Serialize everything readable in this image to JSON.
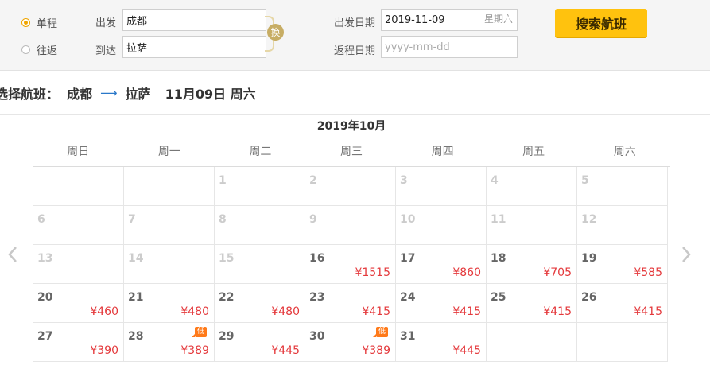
{
  "trip_type": {
    "options": [
      {
        "label": "单程",
        "checked": true
      },
      {
        "label": "往返",
        "checked": false
      }
    ]
  },
  "form": {
    "depart_label": "出发",
    "arrive_label": "到达",
    "depart_city": "成都",
    "arrive_city": "拉萨",
    "swap_label": "换",
    "depart_date_label": "出发日期",
    "return_date_label": "返程日期",
    "depart_date": "2019-11-09",
    "depart_weekday": "星期六",
    "return_date_placeholder": "yyyy-mm-dd",
    "search_button": "搜索航班"
  },
  "heading": {
    "prefix": "选择航班：",
    "from": "成都",
    "arrow": "⟶",
    "to": "拉萨",
    "date": "11月09日 周六"
  },
  "calendar": {
    "month_title": "2019年10月",
    "weekdays": [
      "周日",
      "周一",
      "周二",
      "周三",
      "周四",
      "周五",
      "周六"
    ],
    "prev_icon": "chevron-left-icon",
    "next_icon": "chevron-right-icon",
    "low_badge": "低",
    "cells": [
      {
        "day": "",
        "price": "",
        "disabled": true,
        "low": false
      },
      {
        "day": "",
        "price": "",
        "disabled": true,
        "low": false
      },
      {
        "day": "1",
        "price": "--",
        "disabled": true,
        "low": false
      },
      {
        "day": "2",
        "price": "--",
        "disabled": true,
        "low": false
      },
      {
        "day": "3",
        "price": "--",
        "disabled": true,
        "low": false
      },
      {
        "day": "4",
        "price": "--",
        "disabled": true,
        "low": false
      },
      {
        "day": "5",
        "price": "--",
        "disabled": true,
        "low": false
      },
      {
        "day": "6",
        "price": "--",
        "disabled": true,
        "low": false
      },
      {
        "day": "7",
        "price": "--",
        "disabled": true,
        "low": false
      },
      {
        "day": "8",
        "price": "--",
        "disabled": true,
        "low": false
      },
      {
        "day": "9",
        "price": "--",
        "disabled": true,
        "low": false
      },
      {
        "day": "10",
        "price": "--",
        "disabled": true,
        "low": false
      },
      {
        "day": "11",
        "price": "--",
        "disabled": true,
        "low": false
      },
      {
        "day": "12",
        "price": "--",
        "disabled": true,
        "low": false
      },
      {
        "day": "13",
        "price": "--",
        "disabled": true,
        "low": false
      },
      {
        "day": "14",
        "price": "--",
        "disabled": true,
        "low": false
      },
      {
        "day": "15",
        "price": "--",
        "disabled": true,
        "low": false
      },
      {
        "day": "16",
        "price": "¥1515",
        "disabled": false,
        "low": false
      },
      {
        "day": "17",
        "price": "¥860",
        "disabled": false,
        "low": false
      },
      {
        "day": "18",
        "price": "¥705",
        "disabled": false,
        "low": false
      },
      {
        "day": "19",
        "price": "¥585",
        "disabled": false,
        "low": false
      },
      {
        "day": "20",
        "price": "¥460",
        "disabled": false,
        "low": false
      },
      {
        "day": "21",
        "price": "¥480",
        "disabled": false,
        "low": false
      },
      {
        "day": "22",
        "price": "¥480",
        "disabled": false,
        "low": false
      },
      {
        "day": "23",
        "price": "¥415",
        "disabled": false,
        "low": false
      },
      {
        "day": "24",
        "price": "¥415",
        "disabled": false,
        "low": false
      },
      {
        "day": "25",
        "price": "¥415",
        "disabled": false,
        "low": false
      },
      {
        "day": "26",
        "price": "¥415",
        "disabled": false,
        "low": false
      },
      {
        "day": "27",
        "price": "¥390",
        "disabled": false,
        "low": false
      },
      {
        "day": "28",
        "price": "¥389",
        "disabled": false,
        "low": true
      },
      {
        "day": "29",
        "price": "¥445",
        "disabled": false,
        "low": false
      },
      {
        "day": "30",
        "price": "¥389",
        "disabled": false,
        "low": true
      },
      {
        "day": "31",
        "price": "¥445",
        "disabled": false,
        "low": false
      },
      {
        "day": "",
        "price": "",
        "disabled": true,
        "low": false
      },
      {
        "day": "",
        "price": "",
        "disabled": true,
        "low": false
      }
    ]
  },
  "colors": {
    "accent": "#ffc20e",
    "price": "#e4393c",
    "low_badge": "#ff7a1a",
    "radio_checked": "#f0a500"
  }
}
